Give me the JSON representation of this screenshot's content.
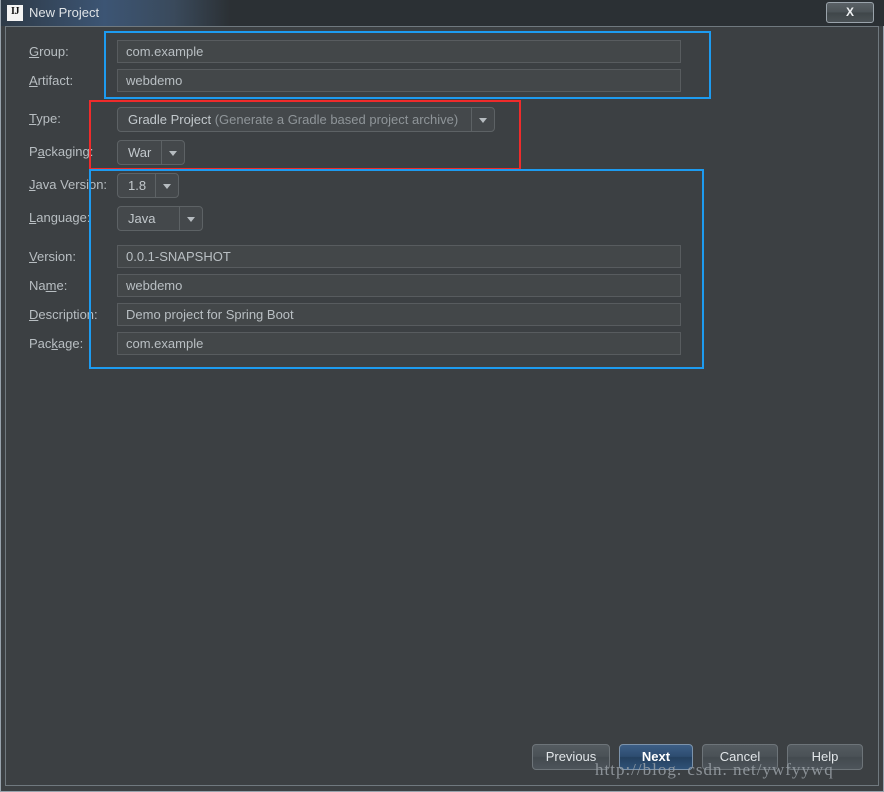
{
  "window": {
    "title": "New Project",
    "app_icon": "IJ",
    "close_label": "X",
    "accent_blue": "#1d9bf0",
    "accent_red": "#ef2b2b",
    "background": "#3c4043"
  },
  "form": {
    "fields": [
      {
        "label_pre": "",
        "label_mn": "G",
        "label_post": "roup:",
        "value": "com.example",
        "type": "text"
      },
      {
        "label_pre": "",
        "label_mn": "A",
        "label_post": "rtifact:",
        "value": "webdemo",
        "type": "text"
      },
      {
        "label_pre": "",
        "label_mn": "T",
        "label_post": "ype:",
        "value": "Gradle Project",
        "value_dim": " (Generate a Gradle based project archive)",
        "type": "combo"
      },
      {
        "label_pre": "P",
        "label_mn": "a",
        "label_post": "ckaging:",
        "value": "War",
        "type": "combo"
      },
      {
        "label_pre": "",
        "label_mn": "J",
        "label_post": "ava Version:",
        "value": "1.8",
        "type": "combo"
      },
      {
        "label_pre": "",
        "label_mn": "L",
        "label_post": "anguage:",
        "value": "Java",
        "type": "combo"
      },
      {
        "label_pre": "",
        "label_mn": "V",
        "label_post": "ersion:",
        "value": "0.0.1-SNAPSHOT",
        "type": "text"
      },
      {
        "label_pre": "Na",
        "label_mn": "m",
        "label_post": "e:",
        "value": "webdemo",
        "type": "text"
      },
      {
        "label_pre": "",
        "label_mn": "D",
        "label_post": "escription:",
        "value": "Demo project for Spring Boot",
        "type": "text"
      },
      {
        "label_pre": "Pac",
        "label_mn": "k",
        "label_post": "age:",
        "value": "com.example",
        "type": "text"
      }
    ]
  },
  "buttons": {
    "previous": "Previous",
    "next": "Next",
    "cancel": "Cancel",
    "help": "Help"
  },
  "watermark": {
    "text": "http://blog. csdn. net/ywfyywq"
  }
}
